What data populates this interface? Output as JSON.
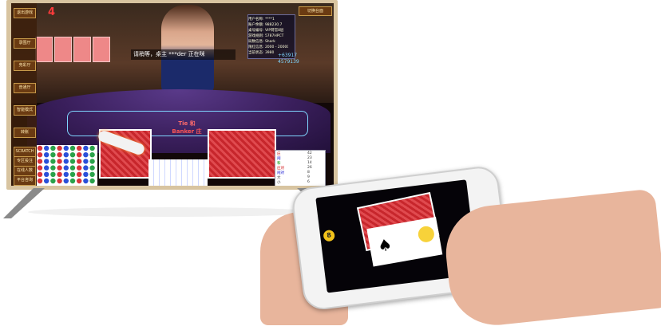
{
  "sidebar": {
    "items": [
      "退出游戏",
      "",
      "录围厅",
      "",
      "竞彩厅",
      "",
      "普通厅",
      "",
      "智能模式",
      "转账",
      "",
      "SCRATCH",
      "专区投注",
      "在线人数",
      "10",
      "关注对象",
      "平台咨询"
    ]
  },
  "screen": {
    "round_number": "4",
    "banner_text": "请稍等，桌主  ***der  正在咪",
    "table_label_tie": "Tie 和",
    "table_label_banker": "Banker 庄",
    "info_panel": {
      "rows": [
        "用户名称: ****1",
        "账户余额: 988230.7",
        "桌号编号: VIP荷官8层",
        "游戏规则: 5787HPCT",
        "局数信息: Shark",
        "限红信息: 2000 - 200000",
        "当前状态: 3980"
      ],
      "balance_1": "+63917",
      "balance_2": "4579139",
      "switch_table": "切换台面"
    },
    "bottom_tabs": [
      "路",
      "庄",
      "闲",
      "和",
      "大",
      "小"
    ],
    "right_panel": {
      "labels": [
        "庄",
        "闲",
        "和",
        "庄对",
        "闲对",
        "大",
        "小",
        "总局"
      ],
      "values": [
        "42",
        "23",
        "14",
        "26",
        "8",
        "9",
        "6"
      ]
    }
  },
  "phone": {
    "chip_label": "8"
  },
  "colors": {
    "tv_frame": "#d8c4a0",
    "table_felt": "#3a1f5c",
    "card_red": "#d9333a",
    "sidebar_brown": "#6b3b12"
  }
}
